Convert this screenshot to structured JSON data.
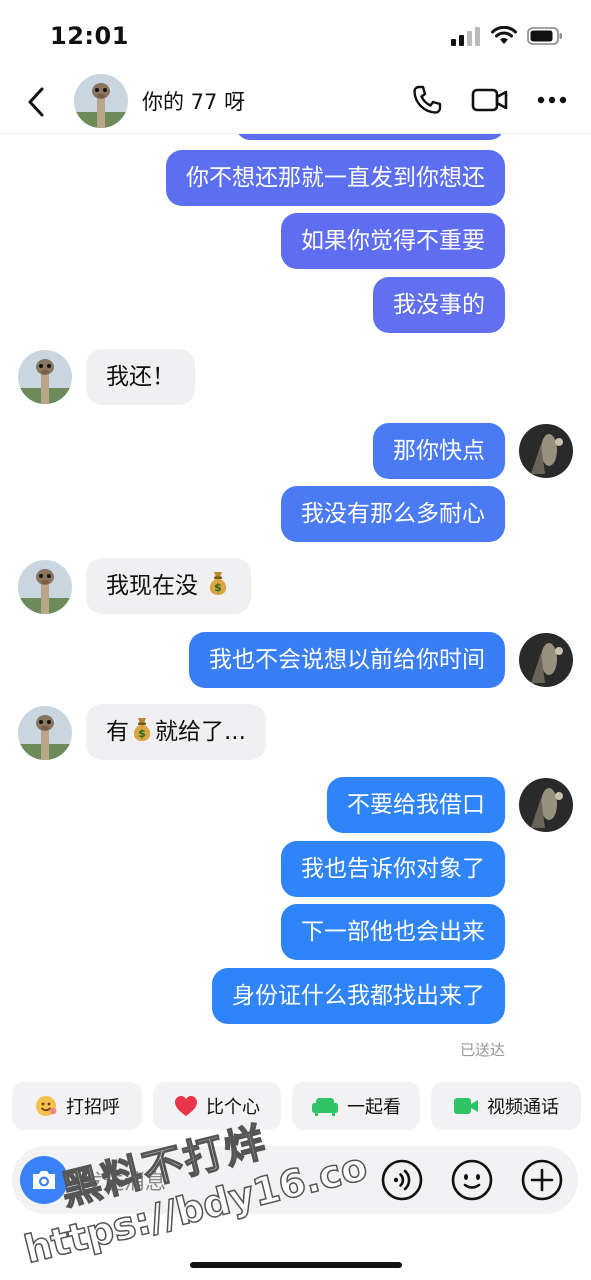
{
  "status": {
    "time": "12:01"
  },
  "header": {
    "contact_name": "你的 77 呀"
  },
  "messages": [
    {
      "dir": "out",
      "text": "你不想还那就一直发到你想还",
      "color": "#5b6ff0"
    },
    {
      "dir": "out",
      "text": "如果你觉得不重要",
      "color": "#5f6ef0"
    },
    {
      "dir": "out",
      "text": "我没事的",
      "color": "#6270ef"
    },
    {
      "dir": "in",
      "text": "我还！"
    },
    {
      "dir": "out",
      "text": "那你快点",
      "color": "#4a7af4"
    },
    {
      "dir": "out",
      "text": "我没有那么多耐心",
      "color": "#4a7af4"
    },
    {
      "dir": "in",
      "text": "我现在没",
      "emoji": "money-bag-icon"
    },
    {
      "dir": "out",
      "text": "我也不会说想以前给你时间",
      "color": "#3a7ef6"
    },
    {
      "dir": "in",
      "text_before": "有",
      "emoji": "money-bag-icon",
      "text_after": "就给了..."
    },
    {
      "dir": "out",
      "text": "不要给我借口",
      "color": "#2e84f8"
    },
    {
      "dir": "out",
      "text": "我也告诉你对象了",
      "color": "#2e84f8"
    },
    {
      "dir": "out",
      "text": "下一部他也会出来",
      "color": "#2e84f8"
    },
    {
      "dir": "out",
      "text": "身份证什么我都找出来了",
      "color": "#2e84f8"
    }
  ],
  "read_receipt": "已送达",
  "quick_actions": [
    {
      "label": "打招呼",
      "icon": "wave-emoji-icon"
    },
    {
      "label": "比个心",
      "icon": "heart-icon"
    },
    {
      "label": "一起看",
      "icon": "sofa-icon"
    },
    {
      "label": "视频通话",
      "icon": "video-camera-icon"
    }
  ],
  "composer": {
    "placeholder": "发送消息"
  },
  "watermark": {
    "line1": "黑料不打烊",
    "line2": "https://bdy16.co"
  },
  "colors": {
    "outgoing_top": "#5b6ff0",
    "outgoing_bottom": "#2e84f8",
    "incoming": "#f0f0f2",
    "accent": "#3a82f7"
  }
}
